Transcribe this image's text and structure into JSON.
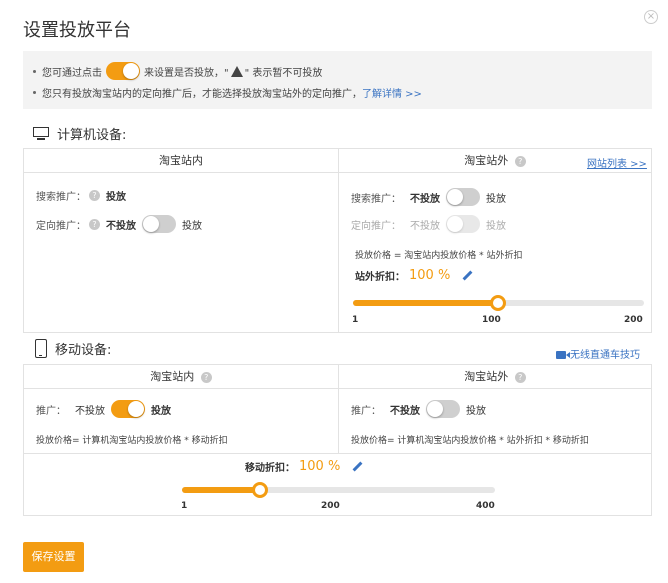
{
  "dialog": {
    "title": "设置投放平台",
    "close": "×"
  },
  "notice": {
    "line1_pre": "您可通过点击",
    "line1_mid": "来设置是否投放，\"",
    "line1_post": "\" 表示暂不可投放",
    "line2_pre": "您只有投放淘宝站内的定向推广后，才能选择投放淘宝站外的定向推广，",
    "line2_link": "了解详情 >>"
  },
  "pc": {
    "title": "计算机设备:",
    "inside": {
      "head": "淘宝站内",
      "search_label": "搜索推广：",
      "search_value": "投放",
      "target_label": "定向推广：",
      "off_label": "不投放",
      "on_label": "投放"
    },
    "outside": {
      "head": "淘宝站外",
      "site_list": "网站列表 >>",
      "search_label": "搜索推广：",
      "target_label": "定向推广：",
      "off_label": "不投放",
      "on_label": "投放",
      "formula": "投放价格 = 淘宝站内投放价格 * 站外折扣",
      "discount_label": "站外折扣：",
      "discount_value": "100 %",
      "slider_value": 100,
      "slider_min": 1,
      "slider_max": 200,
      "ticks": [
        "1",
        "100",
        "200"
      ]
    }
  },
  "mobile": {
    "title": "移动设备:",
    "tips_link": "无线直通车技巧",
    "inside": {
      "head": "淘宝站内",
      "label": "推广：",
      "off_label": "不投放",
      "on_label": "投放",
      "formula": "投放价格= 计算机淘宝站内投放价格 * 移动折扣"
    },
    "outside": {
      "head": "淘宝站外",
      "label": "推广：",
      "off_label": "不投放",
      "on_label": "投放",
      "formula": "投放价格= 计算机淘宝站内投放价格 * 站外折扣 * 移动折扣"
    },
    "discount_label": "移动折扣：",
    "discount_value": "100 %",
    "slider_value": 100,
    "slider_min": 1,
    "slider_max": 400,
    "ticks": [
      "1",
      "200",
      "400"
    ]
  },
  "save_button": "保存设置",
  "colors": {
    "accent": "#f39c12",
    "link": "#3a73c2"
  }
}
